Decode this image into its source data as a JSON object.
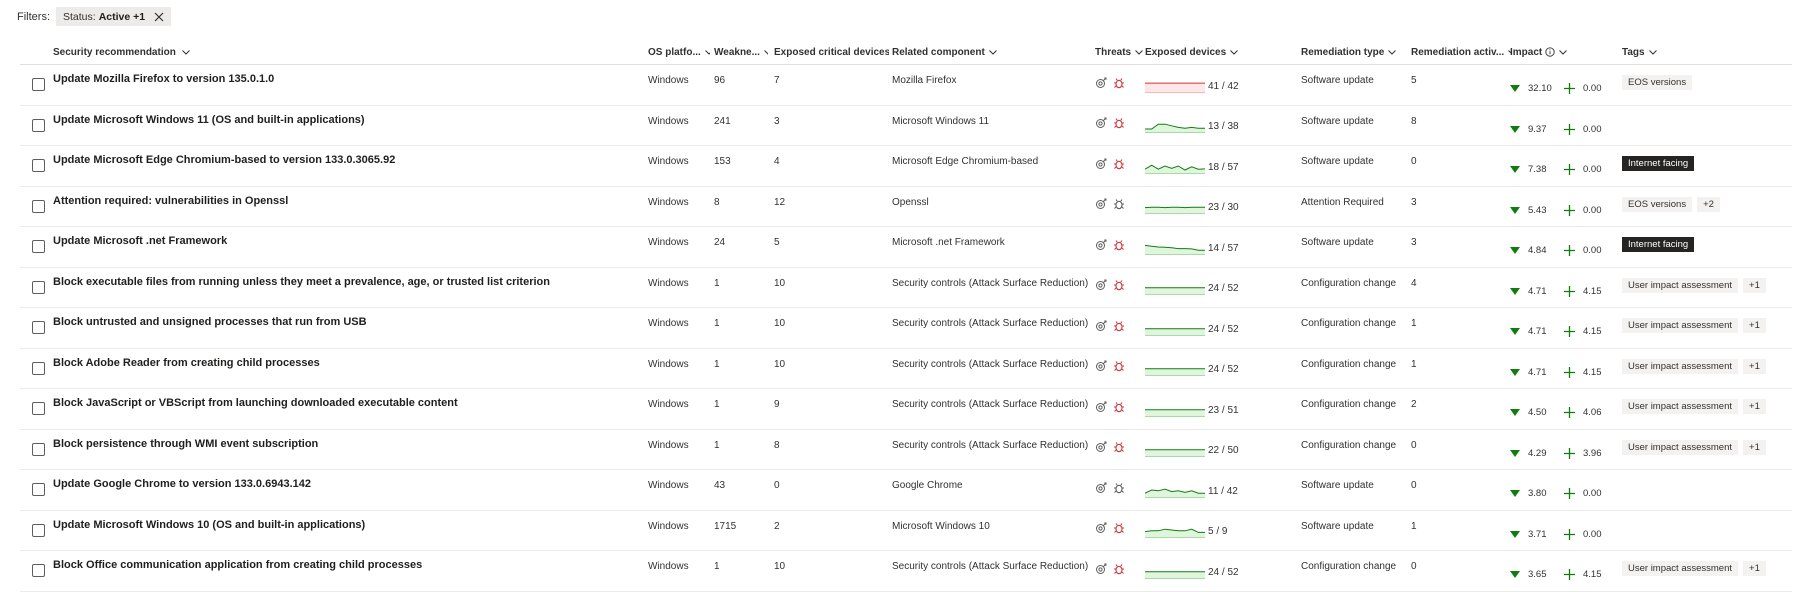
{
  "filters": {
    "label": "Filters:",
    "chip_key": "Status:",
    "chip_value": "Active +1"
  },
  "columns": {
    "name": "Security recommendation",
    "os": "OS platfo...",
    "weak": "Weakne...",
    "exp": "Exposed critical devices",
    "comp": "Related component",
    "thr": "Threats",
    "dev": "Exposed devices",
    "rem": "Remediation type",
    "act": "Remediation activ...",
    "imp": "Impact",
    "tags": "Tags"
  },
  "icons": {
    "filter_close": "close-icon",
    "sort": "chevron-down-icon",
    "info": "info-icon",
    "threat_1": "exploit-icon",
    "threat_2": "bug-icon",
    "impact_down": "triangle-down-icon",
    "impact_up": "plus-icon"
  },
  "colors": {
    "green": "#107c10",
    "red": "#d13438",
    "spark_green_fill": "#dff6dd",
    "spark_red_fill": "#fde7e9"
  },
  "rows": [
    {
      "name": "Update Mozilla Firefox to version 135.0.1.0",
      "os": "Windows",
      "weak": "96",
      "exp": "7",
      "comp": "Mozilla Firefox",
      "threat_active": true,
      "spark_color": "red",
      "spark": [
        0.62,
        0.62,
        0.62,
        0.62,
        0.62,
        0.62,
        0.62,
        0.62,
        0.62,
        0.62
      ],
      "devices": "41 / 42",
      "devices_ratio": 0.976,
      "rem": "Software update",
      "act": "5",
      "imp_down": "32.10",
      "imp_up": "0.00",
      "tags": [
        {
          "text": "EOS versions",
          "dark": false
        }
      ]
    },
    {
      "name": "Update Microsoft Windows 11 (OS and built-in applications)",
      "os": "Windows",
      "weak": "241",
      "exp": "3",
      "comp": "Microsoft Windows 11",
      "threat_active": true,
      "spark_color": "green",
      "spark": [
        0.25,
        0.25,
        0.55,
        0.55,
        0.45,
        0.35,
        0.3,
        0.35,
        0.3,
        0.3
      ],
      "devices": "13 / 38",
      "devices_ratio": 0.342,
      "rem": "Software update",
      "act": "8",
      "imp_down": "9.37",
      "imp_up": "0.00",
      "tags": []
    },
    {
      "name": "Update Microsoft Edge Chromium-based to version 133.0.3065.92",
      "os": "Windows",
      "weak": "153",
      "exp": "4",
      "comp": "Microsoft Edge Chromium-based",
      "threat_active": true,
      "spark_color": "green",
      "spark": [
        0.3,
        0.55,
        0.3,
        0.5,
        0.35,
        0.5,
        0.25,
        0.45,
        0.3,
        0.32
      ],
      "devices": "18 / 57",
      "devices_ratio": 0.316,
      "rem": "Software update",
      "act": "0",
      "imp_down": "7.38",
      "imp_up": "0.00",
      "tags": [
        {
          "text": "Internet facing",
          "dark": true
        }
      ]
    },
    {
      "name": "Attention required: vulnerabilities in Openssl",
      "os": "Windows",
      "weak": "8",
      "exp": "12",
      "comp": "Openssl",
      "threat_active": false,
      "spark_color": "green",
      "spark": [
        0.4,
        0.42,
        0.42,
        0.4,
        0.42,
        0.42,
        0.4,
        0.42,
        0.42,
        0.42
      ],
      "devices": "23 / 30",
      "devices_ratio": 0.767,
      "rem": "Attention Required",
      "act": "3",
      "imp_down": "5.43",
      "imp_up": "0.00",
      "tags": [
        {
          "text": "EOS versions",
          "dark": false
        },
        {
          "text": "+2",
          "dark": false
        }
      ]
    },
    {
      "name": "Update Microsoft .net Framework",
      "os": "Windows",
      "weak": "24",
      "exp": "5",
      "comp": "Microsoft .net Framework",
      "threat_active": true,
      "spark_color": "green",
      "spark": [
        0.6,
        0.55,
        0.5,
        0.48,
        0.45,
        0.4,
        0.4,
        0.38,
        0.3,
        0.3
      ],
      "devices": "14 / 57",
      "devices_ratio": 0.246,
      "rem": "Software update",
      "act": "3",
      "imp_down": "4.84",
      "imp_up": "0.00",
      "tags": [
        {
          "text": "Internet facing",
          "dark": true
        }
      ]
    },
    {
      "name": "Block executable files from running unless they meet a prevalence, age, or trusted list criterion",
      "os": "Windows",
      "weak": "1",
      "exp": "10",
      "comp": "Security controls (Attack Surface Reduction)",
      "threat_active": true,
      "spark_color": "green",
      "spark": [
        0.45,
        0.45,
        0.45,
        0.45,
        0.45,
        0.45,
        0.45,
        0.45,
        0.45,
        0.45
      ],
      "devices": "24 / 52",
      "devices_ratio": 0.462,
      "rem": "Configuration change",
      "act": "4",
      "imp_down": "4.71",
      "imp_up": "4.15",
      "tags": [
        {
          "text": "User impact assessment",
          "dark": false
        },
        {
          "text": "+1",
          "dark": false
        }
      ]
    },
    {
      "name": "Block untrusted and unsigned processes that run from USB",
      "os": "Windows",
      "weak": "1",
      "exp": "10",
      "comp": "Security controls (Attack Surface Reduction)",
      "threat_active": true,
      "spark_color": "green",
      "spark": [
        0.45,
        0.45,
        0.45,
        0.45,
        0.45,
        0.45,
        0.45,
        0.45,
        0.45,
        0.45
      ],
      "devices": "24 / 52",
      "devices_ratio": 0.462,
      "rem": "Configuration change",
      "act": "1",
      "imp_down": "4.71",
      "imp_up": "4.15",
      "tags": [
        {
          "text": "User impact assessment",
          "dark": false
        },
        {
          "text": "+1",
          "dark": false
        }
      ]
    },
    {
      "name": "Block Adobe Reader from creating child processes",
      "os": "Windows",
      "weak": "1",
      "exp": "10",
      "comp": "Security controls (Attack Surface Reduction)",
      "threat_active": true,
      "spark_color": "green",
      "spark": [
        0.45,
        0.45,
        0.45,
        0.45,
        0.45,
        0.45,
        0.45,
        0.45,
        0.45,
        0.45
      ],
      "devices": "24 / 52",
      "devices_ratio": 0.462,
      "rem": "Configuration change",
      "act": "1",
      "imp_down": "4.71",
      "imp_up": "4.15",
      "tags": [
        {
          "text": "User impact assessment",
          "dark": false
        },
        {
          "text": "+1",
          "dark": false
        }
      ]
    },
    {
      "name": "Block JavaScript or VBScript from launching downloaded executable content",
      "os": "Windows",
      "weak": "1",
      "exp": "9",
      "comp": "Security controls (Attack Surface Reduction)",
      "threat_active": true,
      "spark_color": "green",
      "spark": [
        0.45,
        0.45,
        0.45,
        0.45,
        0.45,
        0.45,
        0.45,
        0.45,
        0.45,
        0.45
      ],
      "devices": "23 / 51",
      "devices_ratio": 0.451,
      "rem": "Configuration change",
      "act": "2",
      "imp_down": "4.50",
      "imp_up": "4.06",
      "tags": [
        {
          "text": "User impact assessment",
          "dark": false
        },
        {
          "text": "+1",
          "dark": false
        }
      ]
    },
    {
      "name": "Block persistence through WMI event subscription",
      "os": "Windows",
      "weak": "1",
      "exp": "8",
      "comp": "Security controls (Attack Surface Reduction)",
      "threat_active": true,
      "spark_color": "green",
      "spark": [
        0.45,
        0.45,
        0.45,
        0.45,
        0.45,
        0.45,
        0.45,
        0.45,
        0.45,
        0.45
      ],
      "devices": "22 / 50",
      "devices_ratio": 0.44,
      "rem": "Configuration change",
      "act": "0",
      "imp_down": "4.29",
      "imp_up": "3.96",
      "tags": [
        {
          "text": "User impact assessment",
          "dark": false
        },
        {
          "text": "+1",
          "dark": false
        }
      ]
    },
    {
      "name": "Update Google Chrome to version 133.0.6943.142",
      "os": "Windows",
      "weak": "43",
      "exp": "0",
      "comp": "Google Chrome",
      "threat_active": false,
      "spark_color": "green",
      "spark": [
        0.3,
        0.5,
        0.45,
        0.55,
        0.4,
        0.45,
        0.35,
        0.45,
        0.3,
        0.3
      ],
      "devices": "11 / 42",
      "devices_ratio": 0.262,
      "rem": "Software update",
      "act": "0",
      "imp_down": "3.80",
      "imp_up": "0.00",
      "tags": []
    },
    {
      "name": "Update Microsoft Windows 10 (OS and built-in applications)",
      "os": "Windows",
      "weak": "1715",
      "exp": "2",
      "comp": "Microsoft Windows 10",
      "threat_active": true,
      "spark_color": "green",
      "spark": [
        0.4,
        0.45,
        0.45,
        0.55,
        0.5,
        0.45,
        0.45,
        0.55,
        0.35,
        0.35
      ],
      "devices": "5 / 9",
      "devices_ratio": 0.556,
      "rem": "Software update",
      "act": "1",
      "imp_down": "3.71",
      "imp_up": "0.00",
      "tags": []
    },
    {
      "name": "Block Office communication application from creating child processes",
      "os": "Windows",
      "weak": "1",
      "exp": "10",
      "comp": "Security controls (Attack Surface Reduction)",
      "threat_active": true,
      "spark_color": "green",
      "spark": [
        0.45,
        0.45,
        0.45,
        0.45,
        0.45,
        0.45,
        0.45,
        0.45,
        0.45,
        0.45
      ],
      "devices": "24 / 52",
      "devices_ratio": 0.462,
      "rem": "Configuration change",
      "act": "0",
      "imp_down": "3.65",
      "imp_up": "4.15",
      "tags": [
        {
          "text": "User impact assessment",
          "dark": false
        },
        {
          "text": "+1",
          "dark": false
        }
      ]
    }
  ]
}
